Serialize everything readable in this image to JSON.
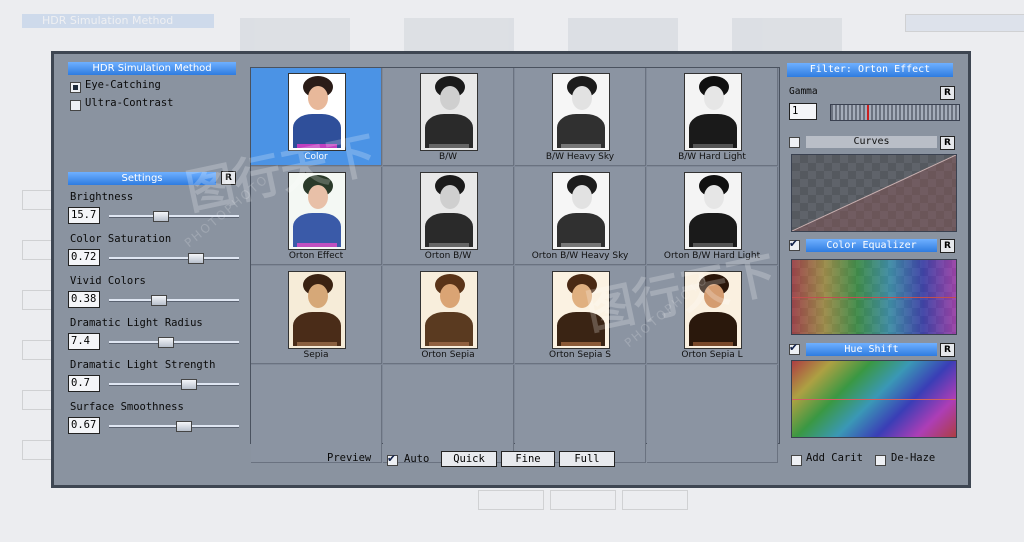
{
  "window": {
    "method_title": "HDR Simulation Method",
    "methods": [
      {
        "label": "Eye-Catching",
        "selected": true
      },
      {
        "label": "Ultra-Contrast",
        "selected": false
      }
    ],
    "settings_title": "Settings",
    "reset_label": "R",
    "settings": [
      {
        "label": "Brightness",
        "value": "15.7",
        "level": 0.38
      },
      {
        "label": "Color Saturation",
        "value": "0.72",
        "level": 0.68
      },
      {
        "label": "Vivid Colors",
        "value": "0.38",
        "level": 0.36
      },
      {
        "label": "Dramatic Light Radius",
        "value": "7.4",
        "level": 0.42
      },
      {
        "label": "Dramatic Light Strength",
        "value": "0.7",
        "level": 0.62
      },
      {
        "label": "Surface Smoothness",
        "value": "0.67",
        "level": 0.58
      }
    ]
  },
  "presets": [
    {
      "label": "Color",
      "style": "color",
      "selected": true
    },
    {
      "label": "B/W",
      "style": "bw"
    },
    {
      "label": "B/W Heavy Sky",
      "style": "bwsky"
    },
    {
      "label": "B/W Hard Light",
      "style": "bwhard"
    },
    {
      "label": "Orton Effect",
      "style": "orton"
    },
    {
      "label": "Orton B/W",
      "style": "bw"
    },
    {
      "label": "Orton B/W Heavy Sky",
      "style": "bwsky"
    },
    {
      "label": "Orton B/W Hard Light",
      "style": "bwhard"
    },
    {
      "label": "Sepia",
      "style": "sepia"
    },
    {
      "label": "Orton Sepia",
      "style": "sepia2"
    },
    {
      "label": "Orton Sepia S",
      "style": "sepia3"
    },
    {
      "label": "Orton Sepia L",
      "style": "sepia4"
    }
  ],
  "filter": {
    "title": "Filter: Orton Effect",
    "gamma_label": "Gamma",
    "gamma_value": "1",
    "curves_label": "Curves",
    "curves_enabled": false,
    "equalizer_label": "Color Equalizer",
    "equalizer_enabled": true,
    "hue_label": "Hue Shift",
    "hue_enabled": true,
    "add_carit_label": "Add Carit",
    "dehaze_label": "De-Haze"
  },
  "preview": {
    "label": "Preview",
    "auto_label": "Auto",
    "auto_checked": true,
    "buttons": [
      "Quick",
      "Fine",
      "Full"
    ]
  },
  "colors": {
    "accent": "#4b93e5",
    "window": "#8a93a0",
    "frame": "#3e4652"
  },
  "watermark": "PHOTOPHOTO"
}
